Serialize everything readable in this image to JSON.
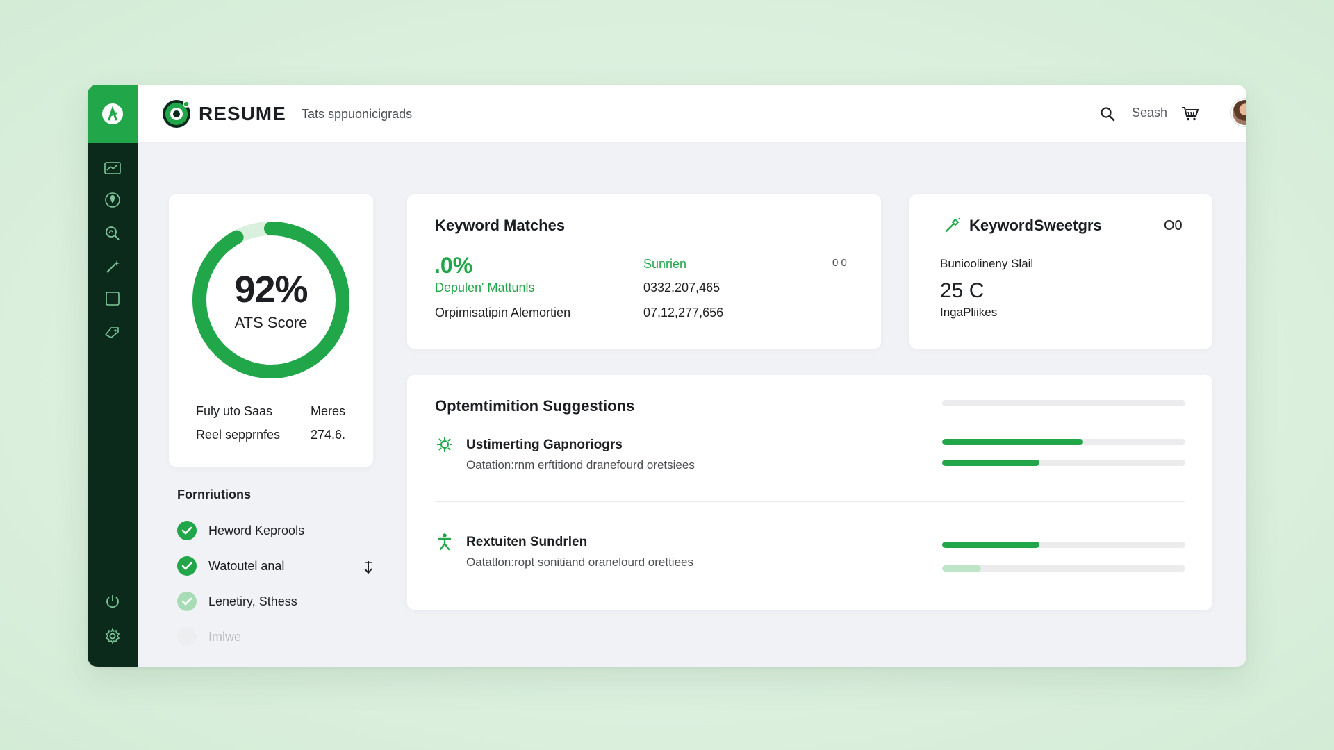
{
  "header": {
    "logo_text": "RESUME",
    "subtitle": "Tats sppuonicigrads",
    "search_label": "Seash"
  },
  "score_card": {
    "percent": "92%",
    "label": "ATS Score",
    "score_value": 0.92,
    "rows": [
      {
        "label": "Fuly uto Saas",
        "value": "Meres"
      },
      {
        "label": "Reel sepprnfes",
        "value": "274.6."
      }
    ]
  },
  "functions": {
    "title": "Fornriutions",
    "items": [
      {
        "label": "Heword Keprools",
        "state": "done"
      },
      {
        "label": "Watoutel anal",
        "state": "done"
      },
      {
        "label": "Lenetiry, Sthess",
        "state": "partial"
      },
      {
        "label": "Imlwe",
        "state": "pending"
      }
    ]
  },
  "keyword_matches": {
    "title": "Keyword Matches",
    "percent": ".0%",
    "col2_header": "Sunrien",
    "badge": "0 0",
    "rows": [
      {
        "label": "Depulen' Mattunls",
        "value": "0332,207,465"
      },
      {
        "label": "Orpimisatipin Alemortien",
        "value": "07,12,277,656"
      }
    ]
  },
  "keyword_sweet": {
    "title": "KeywordSweetgrs",
    "badge": "O0",
    "label": "Bunioolineny Slail",
    "value": "25 C",
    "sub": "IngaPliikes"
  },
  "optimization": {
    "title": "Optemtimition Suggestions",
    "header_bar": 0,
    "items": [
      {
        "title": "Ustimerting Gapnoriogrs",
        "desc": "Oatation:rnm erftitiond dranefourd oretsiees",
        "bars": [
          0.58,
          0.4
        ]
      },
      {
        "title": "Rextuiten Sundrlen",
        "desc": "Oatatlon:ropt sonitiand oranelourd orettiees",
        "bars": [
          0.4,
          0.16
        ]
      }
    ]
  },
  "colors": {
    "accent": "#21a64a",
    "sidebar": "#0b2a1c",
    "light_accent": "#bfe5c8"
  },
  "icons": {
    "sidebar": [
      "chart-icon",
      "location-icon",
      "search-analyze-icon",
      "magic-wand-icon",
      "document-icon",
      "tag-icon"
    ],
    "sidebar_bottom": [
      "power-icon",
      "settings-icon"
    ]
  }
}
